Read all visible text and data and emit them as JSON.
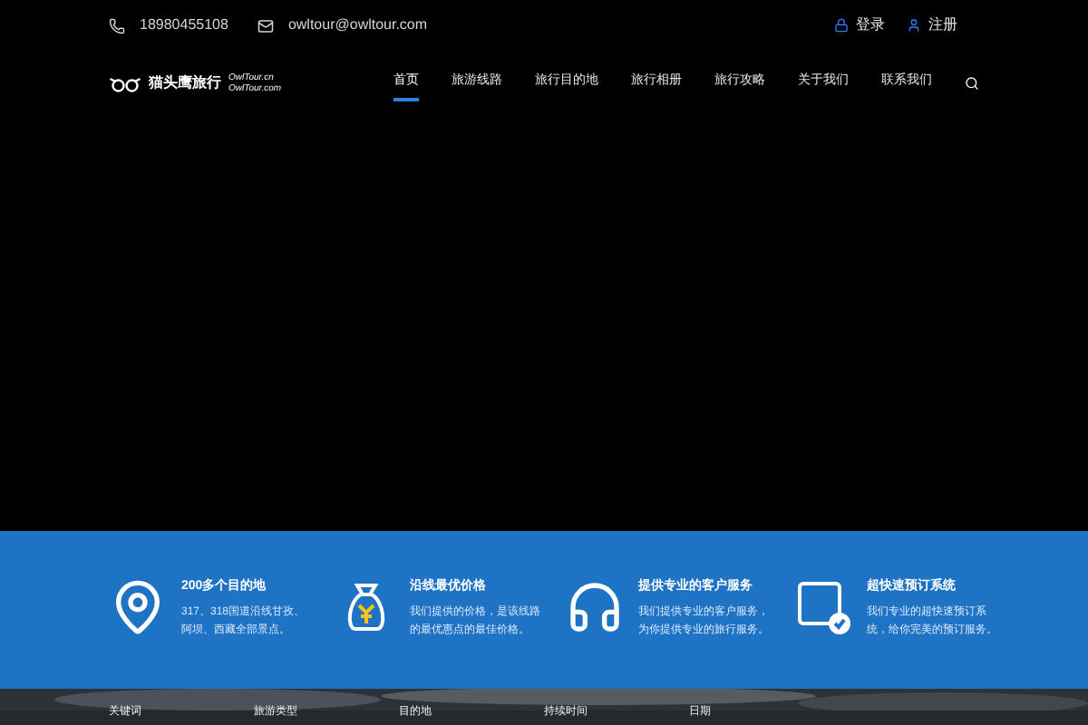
{
  "topbar": {
    "phone": "18980455108",
    "email": "owltour@owltour.com",
    "login": "登录",
    "register": "注册"
  },
  "logo": {
    "name": "猫头鹰旅行",
    "domain_1": "OwlTour.cn",
    "domain_2": "OwlTour.com"
  },
  "nav": [
    {
      "label": "首页",
      "selected": true
    },
    {
      "label": "旅游线路",
      "selected": false
    },
    {
      "label": "旅行目的地",
      "selected": false
    },
    {
      "label": "旅行相册",
      "selected": false
    },
    {
      "label": "旅行攻略",
      "selected": false
    },
    {
      "label": "关于我们",
      "selected": false
    },
    {
      "label": "联系我们",
      "selected": false
    }
  ],
  "features": [
    {
      "kind": "pin",
      "title": "200多个目的地",
      "text": "317、318国道沿线甘孜、阿坝、西藏全部景点。"
    },
    {
      "kind": "money",
      "title": "沿线最优价格",
      "text": "我们提供的价格，是该线路的最优惠点的最佳价格。"
    },
    {
      "kind": "support",
      "title": "提供专业的客户服务",
      "text": "我们提供专业的客户服务，为你提供专业的旅行服务。"
    },
    {
      "kind": "booking",
      "title": "超快速预订系统",
      "text": "我们专业的超快速预订系统，给你完美的预订服务。"
    }
  ],
  "search_labels": [
    "关键词",
    "旅游类型",
    "目的地",
    "持续时间",
    "日期"
  ]
}
